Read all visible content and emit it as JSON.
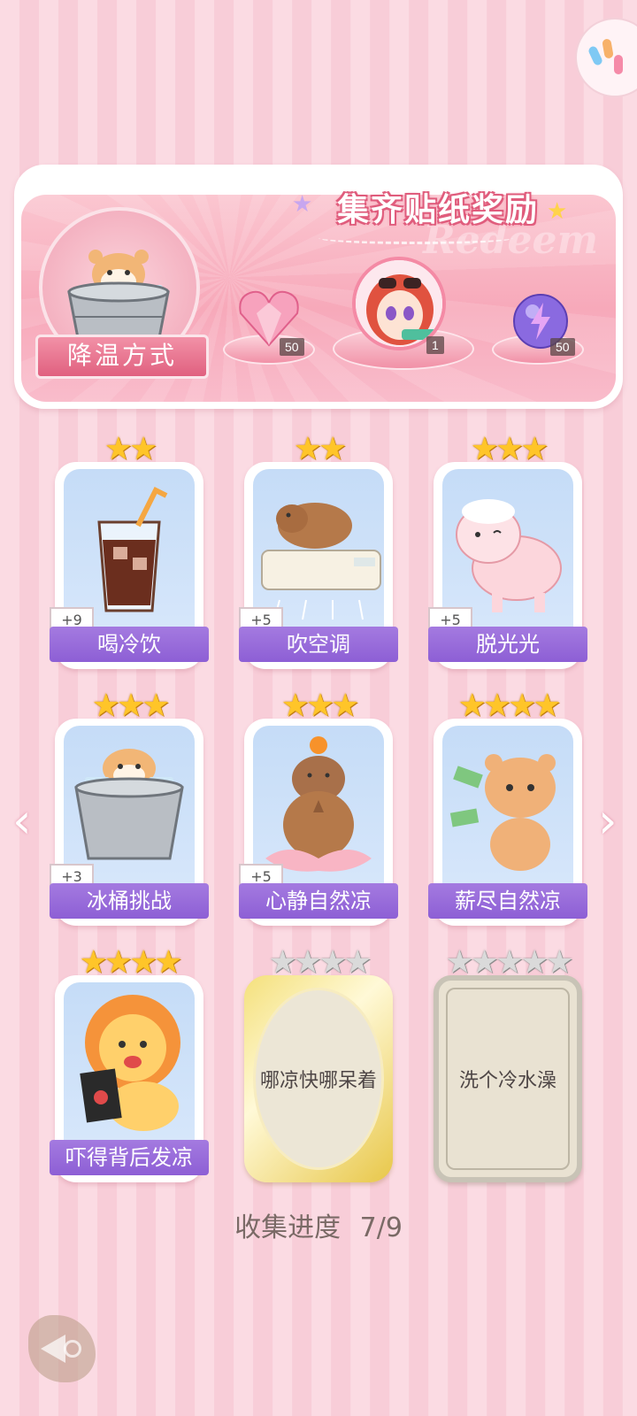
{
  "banner": {
    "title": "集齐贴纸奖励",
    "watermark": "Redeem",
    "current_label": "降温方式",
    "rewards": [
      {
        "icon": "pink-heart-gem-icon",
        "count": "50"
      },
      {
        "icon": "character-avatar-icon",
        "count": "1"
      },
      {
        "icon": "lightning-orb-icon",
        "count": "50"
      }
    ]
  },
  "cards": [
    {
      "label": "喝冷饮",
      "bonus": "+9",
      "stars": 2,
      "icon": "iced-cola-drink-icon"
    },
    {
      "label": "吹空调",
      "bonus": "+5",
      "stars": 2,
      "icon": "capybara-air-conditioner-icon"
    },
    {
      "label": "脱光光",
      "bonus": "+5",
      "stars": 3,
      "icon": "sheared-sheep-icon"
    },
    {
      "label": "冰桶挑战",
      "bonus": "+3",
      "stars": 3,
      "icon": "hamster-ice-bucket-icon"
    },
    {
      "label": "心静自然凉",
      "bonus": "+5",
      "stars": 3,
      "icon": "meditating-capybara-icon"
    },
    {
      "label": "薪尽自然凉",
      "bonus": "",
      "stars": 4,
      "icon": "crying-bear-money-icon"
    },
    {
      "label": "吓得背后发凉",
      "bonus": "",
      "stars": 4,
      "icon": "scared-lion-horror-film-icon"
    }
  ],
  "locked_cards": [
    {
      "label": "哪凉快哪呆着",
      "stars": 4
    },
    {
      "label": "洗个冷水澡",
      "stars": 5
    }
  ],
  "progress": {
    "label": "收集进度",
    "value": "7/9"
  }
}
